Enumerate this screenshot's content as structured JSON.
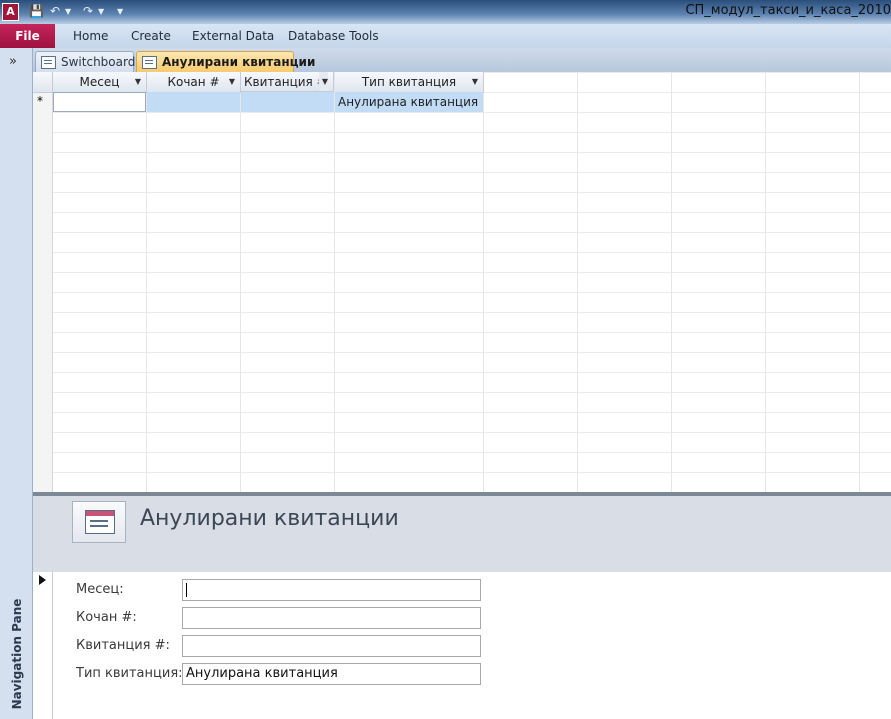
{
  "window": {
    "app_icon_letter": "A",
    "title": "СП_модул_такси_и_каса_2010"
  },
  "ribbon": {
    "file_label": "File",
    "tabs": [
      "Home",
      "Create",
      "External Data",
      "Database Tools"
    ]
  },
  "nav_pane": {
    "toggle_glyph": "»",
    "label": "Navigation Pane"
  },
  "document_tabs": [
    {
      "label": "Switchboard",
      "active": false
    },
    {
      "label": "Анулирани квитанции",
      "active": true
    }
  ],
  "datasheet": {
    "columns": [
      "Месец",
      "Кочан #",
      "Квитанция #",
      "Тип квитанция"
    ],
    "new_row_marker": "*",
    "new_row_values": [
      "",
      "",
      "",
      "Анулирана квитанция"
    ]
  },
  "form": {
    "title": "Анулирани квитанции",
    "fields": [
      {
        "label": "Месец:",
        "value": ""
      },
      {
        "label": "Кочан #:",
        "value": ""
      },
      {
        "label": "Квитанция #:",
        "value": ""
      },
      {
        "label": "Тип квитанция:",
        "value": "Анулирана квитанция"
      }
    ]
  },
  "colors": {
    "file_tab": "#a3163b",
    "active_doc_tab": "#f7c96b",
    "selected_cell": "#c3dcf5"
  }
}
